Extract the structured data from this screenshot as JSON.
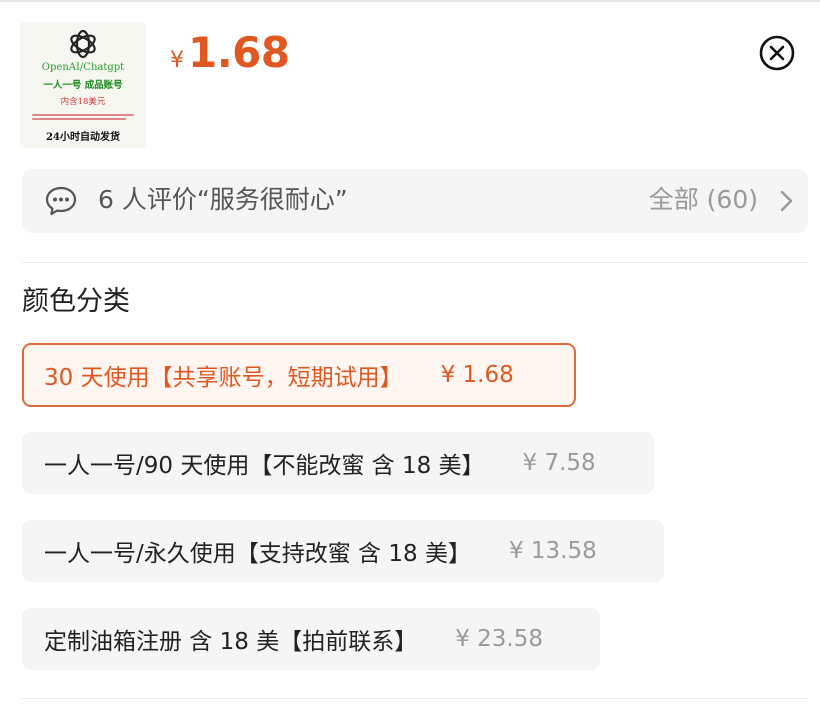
{
  "product": {
    "thumbnail": {
      "logo_icon": "openai-logo-icon",
      "line1": "OpenAI/Chatgpt",
      "line2": "一人一号 成品账号",
      "line3": "内含18美元",
      "line5": "24小时自动发货"
    },
    "price_currency": "¥",
    "price_value": "1.68"
  },
  "close_icon": "close-circle-icon",
  "reviews": {
    "icon": "chat-bubble-icon",
    "text": "6 人评价“服务很耐心”",
    "all_label": "全部 (60)",
    "chevron_icon": "chevron-right-icon"
  },
  "section_title": "颜色分类",
  "options": [
    {
      "name": "30 天使用【共享账号，短期试用】",
      "price": "¥ 1.68",
      "selected": true
    },
    {
      "name": "一人一号/90 天使用【不能改蜜 含 18 美】",
      "price": "¥ 7.58",
      "selected": false
    },
    {
      "name": "一人一号/永久使用【支持改蜜 含 18 美】",
      "price": "¥ 13.58",
      "selected": false
    },
    {
      "name": "定制油箱注册 含 18 美【拍前联系】",
      "price": "¥ 23.58",
      "selected": false
    }
  ],
  "colors": {
    "accent": "#e0571f",
    "selected_border": "#e06b3a",
    "selected_bg": "#fff6f2",
    "option_bg": "#f5f5f5",
    "muted_text": "#999999"
  }
}
